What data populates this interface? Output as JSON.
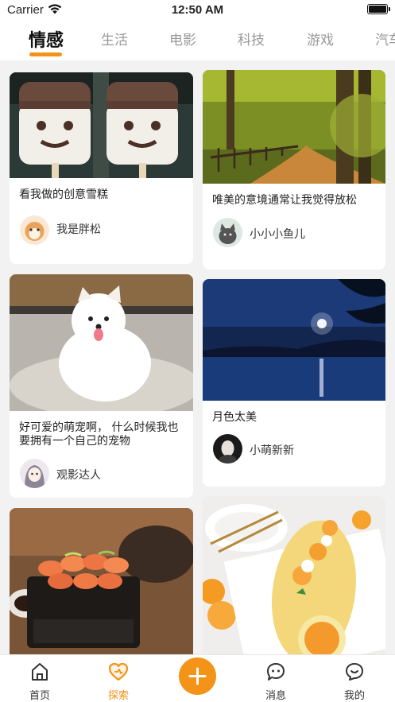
{
  "status_bar": {
    "carrier": "Carrier",
    "time": "12:50 AM"
  },
  "tabs": [
    {
      "label": "情感",
      "active": true
    },
    {
      "label": "生活",
      "active": false
    },
    {
      "label": "电影",
      "active": false
    },
    {
      "label": "科技",
      "active": false
    },
    {
      "label": "游戏",
      "active": false
    },
    {
      "label": "汽车",
      "active": false
    }
  ],
  "feed": {
    "cards": [
      {
        "title": "看我做的创意雪糕",
        "author": "我是胖松",
        "image": "ice-cream-popsicles-photo"
      },
      {
        "title": "唯美的意境通常让我觉得放松",
        "author": "小小小鱼儿",
        "image": "forest-path-photo"
      },
      {
        "title": "好可爱的萌宠啊， 什么时候我也要拥有一个自己的宠物",
        "author": "观影达人",
        "image": "white-pomeranian-photo"
      },
      {
        "title": "月色太美",
        "author": "小萌新新",
        "image": "moonlit-lake-photo"
      },
      {
        "title": "",
        "author": "",
        "image": "sushi-on-grill-photo"
      },
      {
        "title": "",
        "author": "",
        "image": "orange-cake-roll-photo"
      }
    ]
  },
  "tabbar": {
    "items": [
      {
        "label": "首页",
        "icon": "home-icon",
        "active": false
      },
      {
        "label": "探索",
        "icon": "heart-icon",
        "active": true
      },
      {
        "label": "",
        "icon": "plus-icon",
        "active": false
      },
      {
        "label": "消息",
        "icon": "message-icon",
        "active": false
      },
      {
        "label": "我的",
        "icon": "profile-icon",
        "active": false
      }
    ]
  },
  "colors": {
    "accent": "#f39318",
    "background": "#f2f2f2"
  }
}
